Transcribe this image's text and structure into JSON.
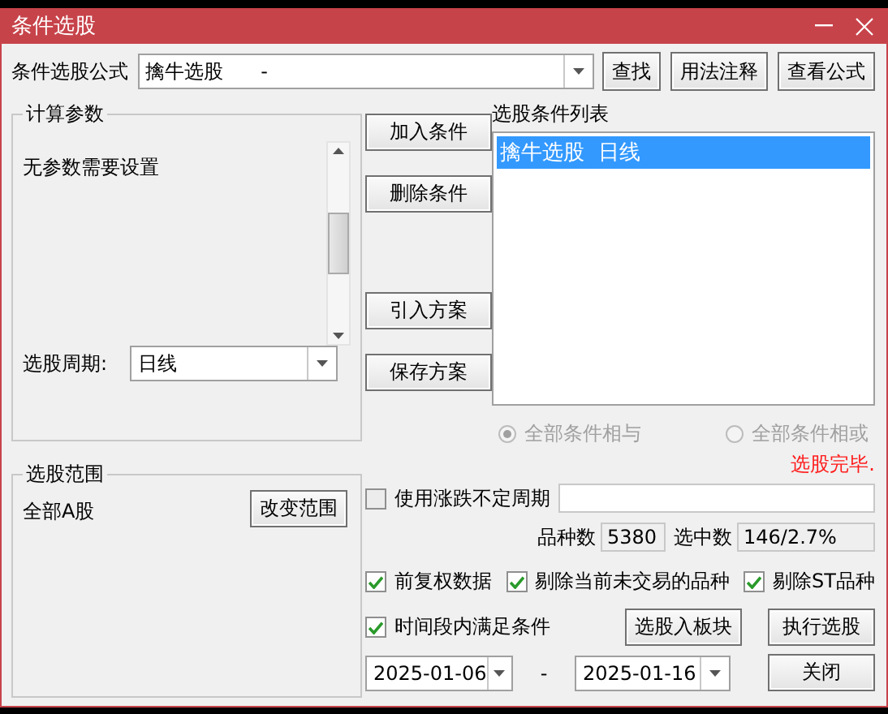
{
  "window": {
    "title": "条件选股"
  },
  "formula": {
    "label": "条件选股公式",
    "value": "擒牛选股      -"
  },
  "formula_buttons": [
    "查找",
    "用法注释",
    "查看公式"
  ],
  "params": {
    "title": "计算参数",
    "message": "无参数需要设置",
    "period_label": "选股周期:",
    "period_value": "日线"
  },
  "condition_buttons": [
    "加入条件",
    "删除条件"
  ],
  "plan_buttons": [
    "引入方案",
    "保存方案"
  ],
  "condition_list": {
    "title": "选股条件列表",
    "items": [
      {
        "label": "擒牛选股  日线",
        "selected": true
      }
    ]
  },
  "combine": {
    "disabled": true,
    "options": [
      {
        "label": "全部条件相与",
        "selected": true
      },
      {
        "label": "全部条件相或",
        "selected": false
      }
    ]
  },
  "status": "选股完毕.",
  "variable_period": {
    "label": "使用涨跌不定周期",
    "checked": false
  },
  "counts": [
    {
      "label": "品种数",
      "value": "5380"
    },
    {
      "label": "选中数",
      "value": "146/2.7%"
    }
  ],
  "options": [
    {
      "label": "前复权数据",
      "checked": true
    },
    {
      "label": "剔除当前未交易的品种",
      "checked": true
    },
    {
      "label": "剔除ST品种",
      "checked": true
    }
  ],
  "time_condition": {
    "label": "时间段内满足条件",
    "checked": true
  },
  "range": {
    "title": "选股范围",
    "value": "全部A股",
    "button": "改变范围"
  },
  "dates": {
    "from": "2025-01-06",
    "separator": "-",
    "to": "2025-01-16"
  },
  "action_buttons": [
    "选股入板块",
    "执行选股",
    "关闭"
  ]
}
